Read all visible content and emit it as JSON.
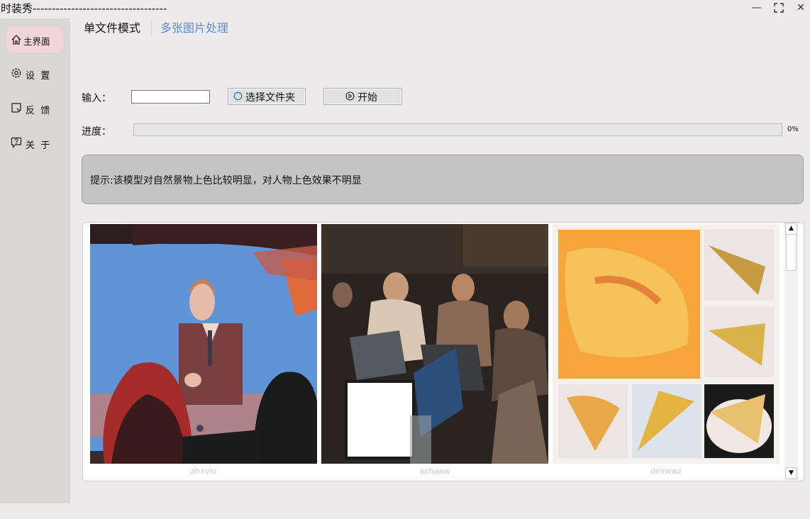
{
  "window": {
    "title": "时装秀-----------------------------------",
    "minimize_glyph": "—",
    "maximize_glyph": "⛶",
    "close_glyph": "✕"
  },
  "sidebar": {
    "items": [
      {
        "label": "主界面",
        "icon": "home-icon",
        "active": true
      },
      {
        "label": "设  置",
        "icon": "gear-icon",
        "active": false
      },
      {
        "label": "反  馈",
        "icon": "feedback-icon",
        "active": false
      },
      {
        "label": "关  于",
        "icon": "help-icon",
        "active": false
      }
    ]
  },
  "tabs": [
    {
      "label": "单文件模式",
      "active": true
    },
    {
      "label": "多张图片处理",
      "active": false
    }
  ],
  "form": {
    "input_label": "输入：",
    "input_value": "",
    "choose_folder_label": "选择文件夹",
    "start_label": "开始",
    "progress_label": "进度：",
    "progress_percent": 0,
    "progress_text": "0%"
  },
  "hint": {
    "text": "提示:该模型对自然景物上色比较明显，对人物上色效果不明显"
  },
  "gallery": {
    "items": [
      {
        "caption": "ahxvlu",
        "subject": "man presenting on stage screen"
      },
      {
        "caption": "aohaaw",
        "subject": "people working on laptops"
      },
      {
        "caption": "dexwwz",
        "subject": "pizza slices collage"
      }
    ]
  },
  "colors": {
    "sidebar_bg": "#d9d6d6",
    "active_nav_bg": "#f1d5da",
    "inactive_tab_text": "#5b8fd6",
    "hint_bg": "#c4c4c4",
    "window_bg": "#eceaea"
  }
}
